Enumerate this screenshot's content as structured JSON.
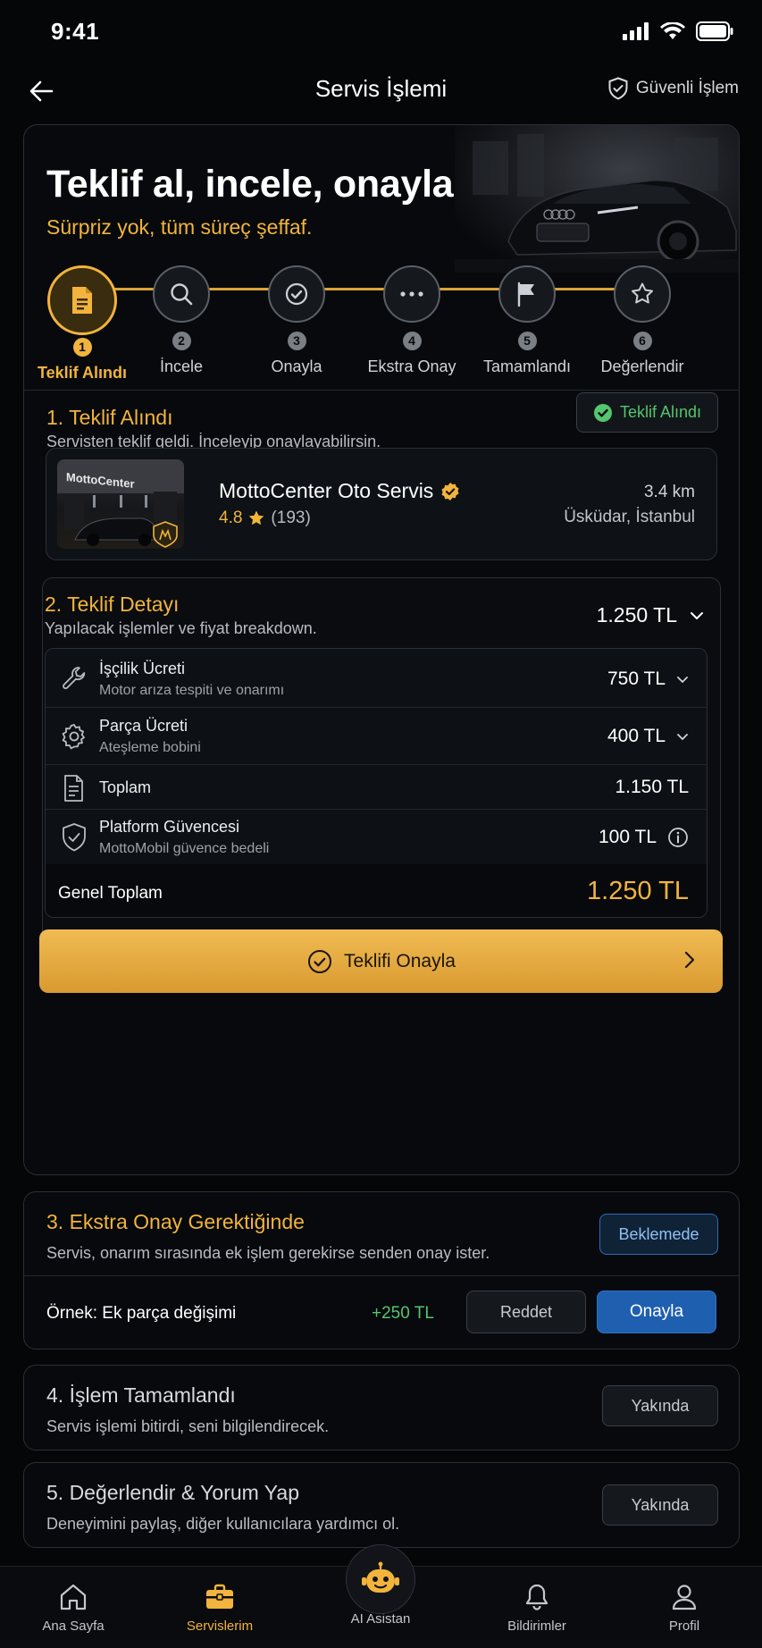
{
  "status_bar": {
    "time": "9:41"
  },
  "header": {
    "title": "Servis İşlemi",
    "secure_label": "Güvenli İşlem"
  },
  "hero": {
    "title": "Teklif al, incele, onayla",
    "subtitle": "Sürpriz yok, tüm süreç şeffaf."
  },
  "steps": [
    {
      "num": "1",
      "label": "Teklif Alındı",
      "icon": "document-icon",
      "active": true
    },
    {
      "num": "2",
      "label": "İncele",
      "icon": "search-icon",
      "active": false
    },
    {
      "num": "3",
      "label": "Onayla",
      "icon": "check-circle-icon",
      "active": false
    },
    {
      "num": "4",
      "label": "Ekstra Onay",
      "icon": "more-icon",
      "active": false
    },
    {
      "num": "5",
      "label": "Tamamlandı",
      "icon": "flag-icon",
      "active": false
    },
    {
      "num": "6",
      "label": "Değerlendir",
      "icon": "star-icon",
      "active": false
    }
  ],
  "section1": {
    "title": "1. Teklif Alındı",
    "desc": "Servisten teklif geldi. İnceleyip onaylayabilirsin.",
    "badge": "Teklif Alındı"
  },
  "provider": {
    "thumb_text": "MottoCenter",
    "name": "MottoCenter Oto Servis",
    "rating": "4.8",
    "reviews": "(193)",
    "distance": "3.4 km",
    "location": "Üsküdar, İstanbul"
  },
  "section2": {
    "title": "2. Teklif Detayı",
    "desc": "Yapılacak işlemler ve fiyat breakdown.",
    "total": "1.250 TL",
    "items": [
      {
        "title": "İşçilik Ücreti",
        "subtitle": "Motor arıza tespiti ve onarımı",
        "amount": "750 TL",
        "icon": "wrench-icon"
      },
      {
        "title": "Parça Ücreti",
        "subtitle": "Ateşleme bobini",
        "amount": "400 TL",
        "icon": "gear-icon"
      },
      {
        "title": "Toplam",
        "subtitle": "",
        "amount": "1.150 TL",
        "icon": "document-icon"
      },
      {
        "title": "Platform Güvencesi",
        "subtitle": "MottoMobil güvence bedeli",
        "amount": "100 TL",
        "icon": "shield-check-icon"
      }
    ],
    "grand_label": "Genel Toplam",
    "grand_value": "1.250 TL",
    "approve_label": "Teklifi Onayla"
  },
  "section3": {
    "title": "3. Ekstra Onay Gerektiğinde",
    "desc": "Servis, onarım sırasında ek işlem gerekirse senden onay ister.",
    "badge": "Beklemede",
    "example_label": "Örnek: Ek parça değişimi",
    "example_amount": "+250 TL",
    "reject_label": "Reddet",
    "approve_label": "Onayla"
  },
  "section4": {
    "title": "4. İşlem Tamamlandı",
    "desc": "Servis işlemi bitirdi, seni bilgilendirecek.",
    "badge": "Yakında"
  },
  "section5": {
    "title": "5. Değerlendir & Yorum Yap",
    "desc": "Deneyimini paylaş, diğer kullanıcılara yardımcı ol.",
    "badge": "Yakında"
  },
  "nav": [
    {
      "label": "Ana Sayfa",
      "icon": "home-icon"
    },
    {
      "label": "Servislerim",
      "icon": "briefcase-icon",
      "active": true
    },
    {
      "label": "AI Asistan",
      "icon": "robot-icon"
    },
    {
      "label": "Bildirimler",
      "icon": "bell-icon"
    },
    {
      "label": "Profil",
      "icon": "user-icon"
    }
  ],
  "colors": {
    "accent": "#F2B43C",
    "success": "#55C56E",
    "primary_blue": "#1F5FB0",
    "background": "#050607"
  }
}
